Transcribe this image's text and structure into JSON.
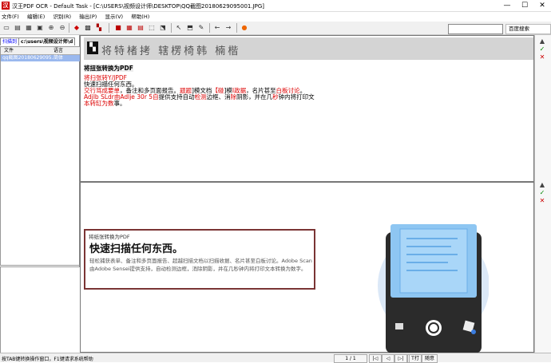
{
  "window": {
    "title": "汉王PDF OCR - Default Task - [C:\\USERS\\视频设计师\\DESKTOP\\QQ截图20180629095001.JPG]",
    "min": "—",
    "max": "☐",
    "close": "✕"
  },
  "menu": [
    "文件(F)",
    "编辑(E)",
    "识别(R)",
    "输出(P)",
    "显示(V)",
    "帮助(H)"
  ],
  "toolbar": {
    "engine": "百度搜索"
  },
  "left": {
    "tab_label": "扫描到",
    "path": "c:\\users\\视频设计师\\d",
    "columns": [
      "文件",
      "语言"
    ],
    "files": [
      {
        "name": "qq截图20180629095…",
        "lang": "简体"
      }
    ]
  },
  "ocr": {
    "banner_text": "将特楮拷 辖楞椅韩 楠楷",
    "line0": "将扭张转换为PDF",
    "line1_red": "将扫张转Y/JPDF",
    "line2": "快速扫描任何东西。",
    "line3a": "交行骂成要单",
    "line3b": "，备注和多页面报告。",
    "line3c": "题题",
    "line3d": "]模文档",
    "line3e": "【碰",
    "line3f": "]模",
    "line3g": "I政据",
    "line3h": "，名片甚至",
    "line3i": "白板讨论",
    "line3j": "。",
    "line4a": "Adjlb SLdr由Adlje 30r 5自",
    "line4b": "提供支持自动",
    "line4c": "检测",
    "line4d": "边框、消",
    "line4e": "除",
    "line4f": "阴影，并在几",
    "line4g": "秒",
    "line4h": "钟内将打印文",
    "line5a": "本转缸为数",
    "line5b": "事",
    "line5c": "。"
  },
  "doc": {
    "small": "将纸张转换为PDF",
    "heading": "快速扫描任何东西。",
    "body": "轻松捕获表单、备注和多页面报告、超越扫描文档以扫描收据、名片甚至白板讨论。Adobe Scan由Adobe Sensei提供支持，自动检测边框，消除阴影，并在几秒钟内将打印文本转换为数字。"
  },
  "status": {
    "text": "按TAB键转换操作窗口，F1键请求系统帮助",
    "page": "1 / 1",
    "btn1": "|◁",
    "btn2": "◁",
    "btn3": "▷|",
    "btn4": "▷",
    "btn5": "T打",
    "btn6": "随意"
  }
}
